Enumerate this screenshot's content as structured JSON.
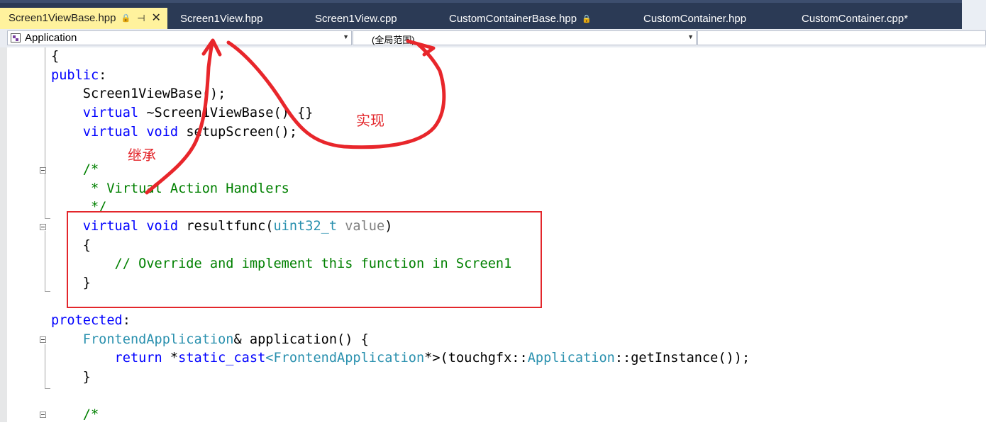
{
  "tabs": [
    {
      "label": "Screen1ViewBase.hpp",
      "active": true,
      "lock": "🔒",
      "pin": "⊣",
      "close": "✕"
    },
    {
      "label": "Screen1View.hpp"
    },
    {
      "label": "Screen1View.cpp"
    },
    {
      "label": "CustomContainerBase.hpp",
      "lock": "🔒"
    },
    {
      "label": "CustomContainer.hpp"
    },
    {
      "label": "CustomContainer.cpp*"
    }
  ],
  "nav": {
    "class_combo": "Application",
    "scope_combo": "(全局范围)",
    "arrow": "▼"
  },
  "code_lines": {
    "l1": "{",
    "l2_kw": "public",
    "l2_p": ":",
    "l3": "    Screen1ViewBase();",
    "l4_kw": "    virtual",
    "l4_rest": " ~Screen1ViewBase() {}",
    "l5_kw": "    virtual void",
    "l5_rest": " setupScreen();",
    "l7": "    /*",
    "l8": "     * Virtual Action Handlers",
    "l9": "     */",
    "l10_kw": "    virtual void",
    "l10_name": " resultfunc(",
    "l10_type": "uint32_t",
    "l10_param": " value",
    "l10_close": ")",
    "l11": "    {",
    "l12": "        // Override and implement this function in Screen1",
    "l13": "    }",
    "l15_kw": "protected",
    "l15_p": ":",
    "l16_type": "    FrontendApplication",
    "l16_rest": "& application() {",
    "l17_kw": "        return",
    "l17_a": " *",
    "l17_kw2": "static_cast",
    "l17_b": "<",
    "l17_type": "FrontendApplication",
    "l17_c": "*>(touchgfx::",
    "l17_type2": "Application",
    "l17_d": "::getInstance());",
    "l18": "    }",
    "l20": "    /*"
  },
  "annotations": {
    "inherit": "继承",
    "implement": "实现"
  },
  "colors": {
    "annotation_red": "#e3262b",
    "keyword": "#0000ff",
    "comment": "#008000",
    "type": "#2b91af",
    "active_tab": "#fff29d",
    "tab_strip": "#2b3a55"
  }
}
